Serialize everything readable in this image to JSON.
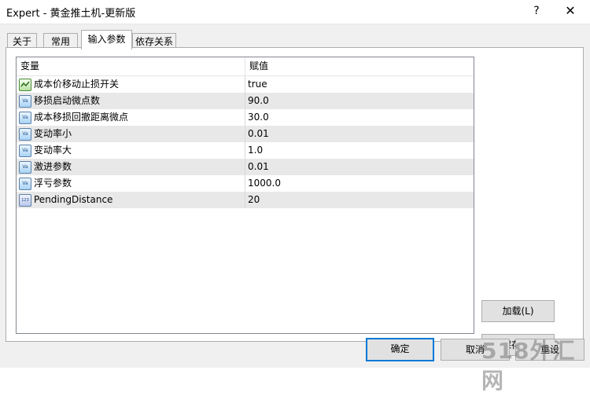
{
  "window": {
    "title": "Expert - 黄金推土机-更新版",
    "help_label": "?",
    "close_label": "✕"
  },
  "tabs": [
    {
      "label": "关于",
      "active": false
    },
    {
      "label": "常用",
      "active": false
    },
    {
      "label": "输入参数",
      "active": true
    },
    {
      "label": "依存关系",
      "active": false
    }
  ],
  "table": {
    "headers": {
      "variable": "变量",
      "value": "赋值"
    },
    "rows": [
      {
        "name": "成本价移动止损开关",
        "value": "true",
        "icon": "bool-icon"
      },
      {
        "name": "移损启动微点数",
        "value": "90.0",
        "icon": "double-icon"
      },
      {
        "name": "成本移损回撤距离微点",
        "value": "30.0",
        "icon": "double-icon"
      },
      {
        "name": "变动率小",
        "value": "0.01",
        "icon": "double-icon"
      },
      {
        "name": "变动率大",
        "value": "1.0",
        "icon": "double-icon"
      },
      {
        "name": "激进参数",
        "value": "0.01",
        "icon": "double-icon"
      },
      {
        "name": "浮亏参数",
        "value": "1000.0",
        "icon": "double-icon"
      },
      {
        "name": "PendingDistance",
        "value": "20",
        "icon": "integer-icon"
      }
    ]
  },
  "side_buttons": {
    "load_label": "加载(L)",
    "save_label": "保存(S)"
  },
  "footer_buttons": {
    "ok_label": "确定",
    "cancel_label": "取消",
    "reset_label": "重设"
  },
  "watermark": "518外汇网"
}
